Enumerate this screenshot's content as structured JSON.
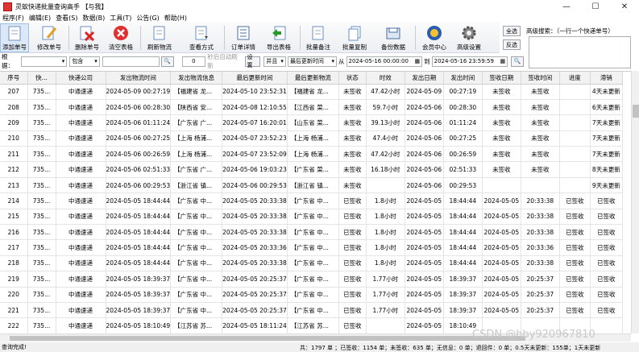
{
  "window": {
    "title": "灵蚁快递批量查询高手 【与我】",
    "minimize": "—",
    "maximize": "☐",
    "close": "✕"
  },
  "menu": [
    "程序(F)",
    "编辑(E)",
    "查看(S)",
    "数据(B)",
    "工具(T)",
    "公告(G)",
    "帮助(H)"
  ],
  "toolbar": {
    "add": "添加单号",
    "edit": "修改单号",
    "delete": "删除单号",
    "clear": "清空表格",
    "refresh": "刷新物流",
    "view_mode": "查看方式",
    "order_detail": "订单详情",
    "export": "导出表格",
    "batch_note": "批量备注",
    "batch_copy": "批量复制",
    "backup": "备份数据",
    "member": "会员中心",
    "advanced": "高级设置"
  },
  "side_buttons": {
    "select_all": "全选",
    "invert": "反选"
  },
  "advanced_search": {
    "label": "高级搜索：（一行一个快递单号）",
    "value": ""
  },
  "filter": {
    "by_label": "根据：",
    "by_value": "",
    "contains": "包含",
    "keyword": "",
    "auto_refresh_value": "0",
    "auto_refresh_label": "秒后自动刷新",
    "settings": "设置",
    "and_or": "并且",
    "time_field": "最后更新时间",
    "from_label": "从",
    "from_value": "2024-05-16 00:00:00",
    "to_label": "到",
    "to_value": "2024-05-16 23:59:59"
  },
  "colors": {
    "header_bg": "#f2f2f2",
    "toolbar_bg": "#eceff3"
  },
  "table": {
    "columns": [
      "序号",
      "快...",
      "快递公司",
      "发出物流时间",
      "发出物流信息",
      "最后更新时间",
      "最后更新物流",
      "状态",
      "时效",
      "发出日期",
      "发出时间",
      "签收日期",
      "签收时间",
      "进度",
      "滞销"
    ],
    "rows": [
      [
        "207",
        "735...",
        "中通速递",
        "2024-05-09 00:27:19",
        "【福建省 龙...",
        "2024-05-10 23:52:31",
        "【福建省 龙...",
        "未签收",
        "47.42小时",
        "2024-05-09",
        "00:27:19",
        "未签收",
        "未签收",
        "",
        "4天未更新"
      ],
      [
        "208",
        "735...",
        "中通速递",
        "2024-05-06 00:28:30",
        "【陕西省 安...",
        "2024-05-08 12:10:55",
        "【江西省 菜...",
        "未签收",
        "59.7小时",
        "2024-05-06",
        "00:28:30",
        "未签收",
        "未签收",
        "",
        "6天未更新"
      ],
      [
        "209",
        "735...",
        "中通速递",
        "2024-05-06 01:11:24",
        "【广东省 广...",
        "2024-05-07 16:20:01",
        "【山东省 菜...",
        "未签收",
        "39.13小时",
        "2024-05-06",
        "01:11:24",
        "未签收",
        "未签收",
        "",
        "7天未更新"
      ],
      [
        "210",
        "735...",
        "中通速递",
        "2024-05-06 00:27:25",
        "【上海 杨浦...",
        "2024-05-07 23:52:23",
        "【上海 杨浦...",
        "未签收",
        "47.4小时",
        "2024-05-06",
        "00:27:25",
        "未签收",
        "未签收",
        "",
        "7天未更新"
      ],
      [
        "211",
        "735...",
        "中通速递",
        "2024-05-06 00:26:59",
        "【上海 杨浦...",
        "2024-05-07 23:52:09",
        "【上海 杨浦...",
        "未签收",
        "47.42小时",
        "2024-05-06",
        "00:26:59",
        "未签收",
        "未签收",
        "",
        "7天未更新"
      ],
      [
        "212",
        "735...",
        "中通速递",
        "2024-05-06 02:51:33",
        "【广东省 广...",
        "2024-05-06 19:03:23",
        "【广东省 菜...",
        "未签收",
        "16.18小时",
        "2024-05-06",
        "02:51:33",
        "未签收",
        "未签收",
        "",
        "8天未更新"
      ],
      [
        "213",
        "735...",
        "中通速递",
        "2024-05-06 00:29:53",
        "【浙江省 镇...",
        "2024-05-06 00:29:53",
        "【浙江省 镇...",
        "未签收",
        "",
        "2024-05-06",
        "00:29:53",
        "",
        "",
        "",
        "9天未更新"
      ],
      [
        "214",
        "735...",
        "中通速递",
        "2024-05-05 18:44:44",
        "【广东省 中...",
        "2024-05-05 20:33:38",
        "【广东省 中...",
        "已签收",
        "1.8小时",
        "2024-05-05",
        "18:44:44",
        "2024-05-05",
        "20:33:38",
        "已签收",
        "已签收"
      ],
      [
        "215",
        "735...",
        "中通速递",
        "2024-05-05 18:44:44",
        "【广东省 中...",
        "2024-05-05 20:33:38",
        "【广东省 中...",
        "已签收",
        "1.8小时",
        "2024-05-05",
        "18:44:44",
        "2024-05-05",
        "20:33:38",
        "已签收",
        "已签收"
      ],
      [
        "216",
        "735...",
        "中通速递",
        "2024-05-05 18:44:44",
        "【广东省 中...",
        "2024-05-05 20:33:38",
        "【广东省 中...",
        "已签收",
        "1.8小时",
        "2024-05-05",
        "18:44:44",
        "2024-05-05",
        "20:33:38",
        "已签收",
        "已签收"
      ],
      [
        "217",
        "735...",
        "中通速递",
        "2024-05-05 18:44:44",
        "【广东省 中...",
        "2024-05-05 20:33:36",
        "【广东省 中...",
        "已签收",
        "1.8小时",
        "2024-05-05",
        "18:44:44",
        "2024-05-05",
        "20:33:36",
        "已签收",
        "已签收"
      ],
      [
        "218",
        "735...",
        "中通速递",
        "2024-05-05 18:44:44",
        "【广东省 中...",
        "2024-05-05 20:33:38",
        "【广东省 中...",
        "已签收",
        "1.8小时",
        "2024-05-05",
        "18:44:44",
        "2024-05-05",
        "20:33:38",
        "已签收",
        "已签收"
      ],
      [
        "219",
        "735...",
        "中通速递",
        "2024-05-05 18:39:37",
        "【广东省 中...",
        "2024-05-05 20:25:37",
        "【广东省 中...",
        "已签收",
        "1.77小时",
        "2024-05-05",
        "18:39:37",
        "2024-05-05",
        "20:25:37",
        "已签收",
        "已签收"
      ],
      [
        "220",
        "735...",
        "中通速递",
        "2024-05-05 18:39:37",
        "【广东省 中...",
        "2024-05-05 20:25:37",
        "【广东省 中...",
        "已签收",
        "1.77小时",
        "2024-05-05",
        "18:39:37",
        "2024-05-05",
        "20:25:37",
        "已签收",
        "已签收"
      ],
      [
        "221",
        "735...",
        "中通速递",
        "2024-05-05 18:39:37",
        "【广东省 中...",
        "2024-05-05 20:25:37",
        "【广东省 中...",
        "已签收",
        "1.77小时",
        "2024-05-05",
        "18:39:37",
        "2024-05-05",
        "20:25:37",
        "已签收",
        "已签收"
      ],
      [
        "222",
        "735...",
        "中通速递",
        "2024-05-05 18:10:49",
        "【江苏省 苏...",
        "2024-05-05 18:11:24",
        "【江苏省 苏...",
        "已签收",
        "",
        "2024-05-05",
        "18:10:49",
        "",
        "",
        "",
        ""
      ]
    ]
  },
  "status": {
    "left": "查询完成!",
    "right": "共：1797 单 ；已签收：1154 单；未签收：635 单；无信息：0 单；退回件：0 单；0.5天未更新：155单；1天未更新"
  },
  "watermark": "CSDN @hby920967810"
}
